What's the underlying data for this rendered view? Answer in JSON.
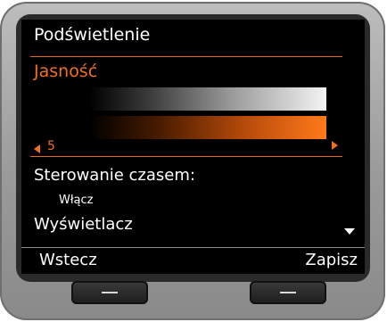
{
  "screen": {
    "title": "Podświetlenie",
    "brightness": {
      "label": "Jasność",
      "value": "5"
    },
    "time_control": {
      "label": "Sterowanie czasem:",
      "value": "Włącz"
    },
    "display_label": "Wyświetlacz"
  },
  "softkeys": {
    "left": "Wstecz",
    "right": "Zapisz"
  },
  "icons": {
    "left_arrow": "triangle-left",
    "right_arrow": "triangle-right",
    "scroll_down": "triangle-down",
    "softkey_line": "horizontal-line"
  },
  "colors": {
    "accent": "#f07020",
    "screen_bg": "#000000",
    "device_body": "#a8a8a8"
  }
}
